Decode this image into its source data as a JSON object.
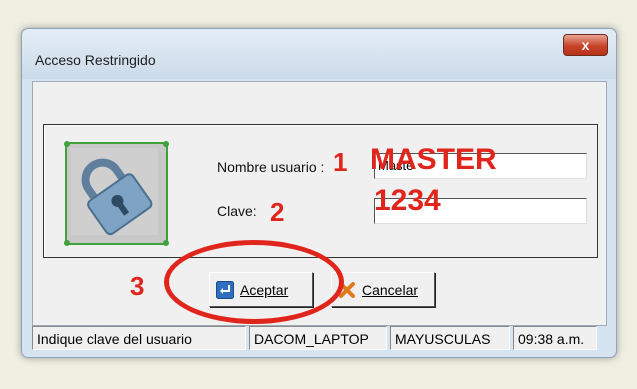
{
  "window": {
    "title": "Acceso Restringido",
    "close_label": "x"
  },
  "form": {
    "username_label": "Nombre usuario :",
    "username_value": "Maste",
    "password_label": "Clave:",
    "password_value": ""
  },
  "annotations": {
    "n1": "1",
    "n2": "2",
    "n3": "3",
    "master": "MASTER",
    "pin": "1234"
  },
  "buttons": {
    "accept_label": "Aceptar",
    "cancel_label": "Cancelar"
  },
  "statusbar": {
    "hint": "Indique clave del usuario",
    "machine": "DACOM_LAPTOP",
    "caps": "MAYUSCULAS",
    "time": "09:38 a.m."
  },
  "icons": {
    "lock": "lock-icon",
    "accept": "enter-icon",
    "cancel": "x-icon"
  },
  "colors": {
    "annotation": "#e0261c",
    "frame": "#3fa13c"
  }
}
